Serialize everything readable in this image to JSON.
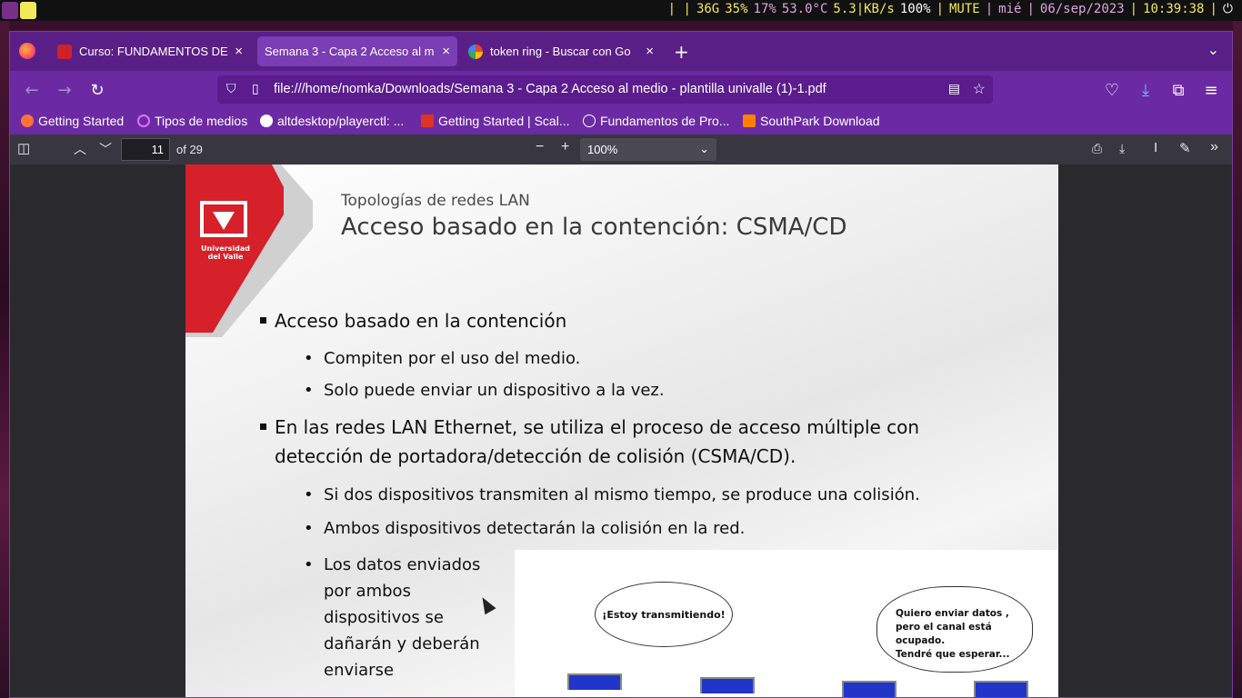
{
  "system_bar": {
    "disk": "36G",
    "mem": "35%",
    "cpu": "17%",
    "temp": "53.0°C",
    "net": "5.3|KB/s",
    "battery": "100%",
    "volume": "MUTE",
    "day": "mié",
    "date": "06/sep/2023",
    "time": "10:39:38"
  },
  "tabs": [
    {
      "label": "Curso: FUNDAMENTOS DE",
      "active": false
    },
    {
      "label": "Semana 3 - Capa 2 Acceso al m",
      "active": true
    },
    {
      "label": "token ring - Buscar con Go",
      "active": false
    }
  ],
  "url": "file:///home/nomka/Downloads/Semana 3 - Capa 2 Acceso al medio - plantilla univalle (1)-1.pdf",
  "bookmarks": [
    "Getting Started",
    "Tipos de medios",
    "altdesktop/playerctl: ...",
    "Getting Started | Scal...",
    "Fundamentos de Pro...",
    "SouthPark Download"
  ],
  "pdf_toolbar": {
    "page_number": "11",
    "page_count": "of 29",
    "zoom": "100%"
  },
  "slide": {
    "logo_text": "Universidad del Valle",
    "subtitle": "Topologías de redes LAN",
    "title": "Acceso basado en la contención: CSMA/CD",
    "bullets": [
      "Acceso basado en la contención",
      "Compiten por el uso del medio.",
      "Solo puede enviar un dispositivo a la vez.",
      "En las redes LAN Ethernet, se utiliza el proceso de acceso múltiple con",
      "detección de portadora/detección de colisión (CSMA/CD).",
      "Si dos dispositivos transmiten al mismo tiempo, se produce una colisión.",
      "Ambos dispositivos detectarán la colisión en la red.",
      "Los datos enviados",
      "por ambos",
      "dispositivos se",
      "dañarán y deberán",
      "enviarse"
    ],
    "diagram": {
      "bubble1": "¡Estoy transmitiendo!",
      "bubble2": "Quiero enviar datos ,\npero el canal está\nocupado.\nTendré que esperar..."
    }
  }
}
